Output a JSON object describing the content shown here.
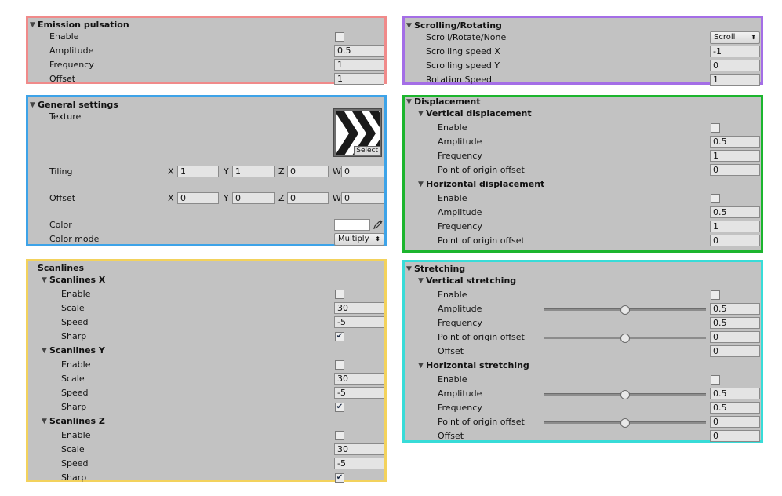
{
  "emission": {
    "title": "Emission pulsation",
    "enable_label": "Enable",
    "amplitude_label": "Amplitude",
    "amplitude_value": "0.5",
    "frequency_label": "Frequency",
    "frequency_value": "1",
    "offset_label": "Offset",
    "offset_value": "1",
    "enabled": false
  },
  "general": {
    "title": "General settings",
    "texture_label": "Texture",
    "select_label": "Select",
    "tiling_label": "Tiling",
    "tiling": {
      "x": "1",
      "y": "1",
      "z": "0",
      "w": "0"
    },
    "offset_label": "Offset",
    "offset": {
      "x": "0",
      "y": "0",
      "z": "0",
      "w": "0"
    },
    "axis": {
      "x": "X",
      "y": "Y",
      "z": "Z",
      "w": "W"
    },
    "color_label": "Color",
    "color_value": "#ffffff",
    "color_mode_label": "Color mode",
    "color_mode_value": "Multiply"
  },
  "scanlines": {
    "title": "Scanlines",
    "enable_label": "Enable",
    "scale_label": "Scale",
    "speed_label": "Speed",
    "sharp_label": "Sharp",
    "x": {
      "title": "Scanlines X",
      "scale": "30",
      "speed": "-5",
      "enabled": false,
      "sharp": true
    },
    "y": {
      "title": "Scanlines Y",
      "scale": "30",
      "speed": "-5",
      "enabled": false,
      "sharp": true
    },
    "z": {
      "title": "Scanlines Z",
      "scale": "30",
      "speed": "-5",
      "enabled": false,
      "sharp": true
    }
  },
  "scrolling": {
    "title": "Scrolling/Rotating",
    "mode_label": "Scroll/Rotate/None",
    "mode_value": "Scroll",
    "speed_x_label": "Scrolling speed X",
    "speed_x_value": "-1",
    "speed_y_label": "Scrolling speed Y",
    "speed_y_value": "0",
    "rotation_label": "Rotation Speed",
    "rotation_value": "1"
  },
  "displacement": {
    "title": "Displacement",
    "enable_label": "Enable",
    "amplitude_label": "Amplitude",
    "frequency_label": "Frequency",
    "origin_label": "Point of origin offset",
    "vertical": {
      "title": "Vertical displacement",
      "amplitude": "0.5",
      "frequency": "1",
      "origin": "0",
      "enabled": false
    },
    "horizontal": {
      "title": "Horizontal displacement",
      "amplitude": "0.5",
      "frequency": "1",
      "origin": "0",
      "enabled": false
    }
  },
  "stretching": {
    "title": "Stretching",
    "enable_label": "Enable",
    "amplitude_label": "Amplitude",
    "frequency_label": "Frequency",
    "origin_label": "Point of origin offset",
    "offset_label": "Offset",
    "vertical": {
      "title": "Vertical stretching",
      "amplitude": "0.5",
      "frequency": "0.5",
      "origin": "0",
      "offset": "0",
      "enabled": false,
      "amplitude_slider": 0.5,
      "origin_slider": 0.5
    },
    "horizontal": {
      "title": "Horizontal stretching",
      "amplitude": "0.5",
      "frequency": "0.5",
      "origin": "0",
      "offset": "0",
      "enabled": false,
      "amplitude_slider": 0.5,
      "origin_slider": 0.5
    }
  },
  "icons": {
    "foldout": "triangle-down-icon",
    "check": "checkmark-icon",
    "picker": "eyedropper-icon"
  },
  "colors": {
    "emission_border": "#f08a8a",
    "general_border": "#3da3e8",
    "scanlines_border": "#f3d25c",
    "scrolling_border": "#a46ee6",
    "displacement_border": "#1cb52e",
    "stretching_border": "#38dcd8",
    "panel_bg": "#c2c2c2"
  }
}
